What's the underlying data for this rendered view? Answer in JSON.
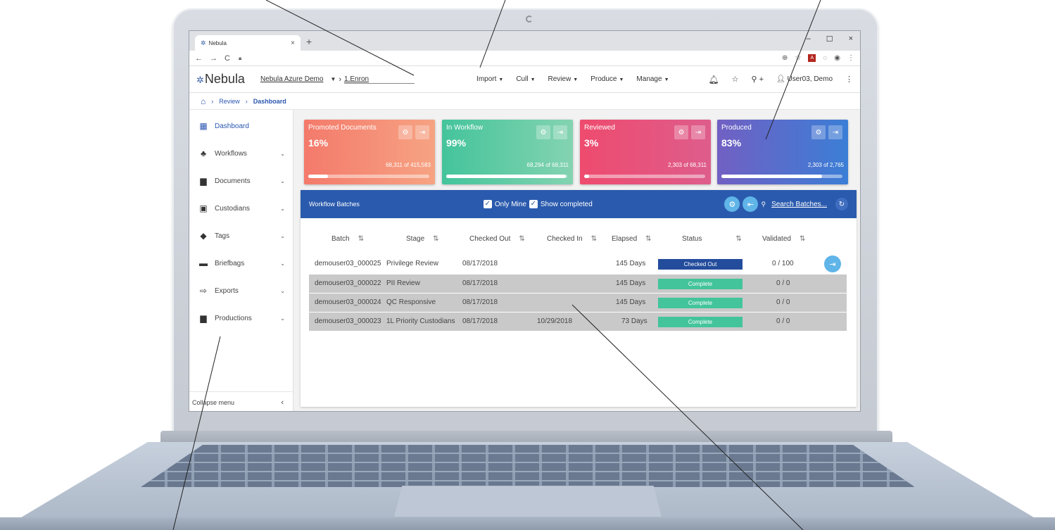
{
  "browser": {
    "tab_title": "Nebula",
    "tab_close": "×",
    "new_tab": "+",
    "min": "–",
    "max": "☐",
    "close": "×"
  },
  "header": {
    "logo": "Nebula",
    "project": "Nebula Azure Demo",
    "case": "1.Enron",
    "menu": [
      "Import",
      "Cull",
      "Review",
      "Produce",
      "Manage"
    ],
    "search_plus": "+",
    "user": "User03, Demo"
  },
  "breadcrumb": [
    "Review",
    "Dashboard"
  ],
  "sidebar": {
    "items": [
      {
        "label": "Dashboard",
        "icon": "dashboard-icon",
        "glyph": "▦"
      },
      {
        "label": "Workflows",
        "icon": "workflow-icon",
        "glyph": "♣"
      },
      {
        "label": "Documents",
        "icon": "document-icon",
        "glyph": "▆"
      },
      {
        "label": "Custodians",
        "icon": "badge-icon",
        "glyph": "▣"
      },
      {
        "label": "Tags",
        "icon": "tag-icon",
        "glyph": "◆"
      },
      {
        "label": "Briefbags",
        "icon": "briefcase-icon",
        "glyph": "▬"
      },
      {
        "label": "Exports",
        "icon": "export-icon",
        "glyph": "⇨"
      },
      {
        "label": "Productions",
        "icon": "file-icon",
        "glyph": "▆"
      }
    ],
    "collapse_label": "Collapse menu"
  },
  "cards": [
    {
      "title": "Promoted Documents",
      "percent": "16%",
      "count": "68,311 of 415,583",
      "fill": 0.16
    },
    {
      "title": "In Workflow",
      "percent": "99%",
      "count": "68,294 of 68,311",
      "fill": 0.99
    },
    {
      "title": "Reviewed",
      "percent": "3%",
      "count": "2,303 of 68,311",
      "fill": 0.03
    },
    {
      "title": "Produced",
      "percent": "83%",
      "count": "2,303 of 2,765",
      "fill": 0.83
    }
  ],
  "batches": {
    "title": "Workflow Batches",
    "only_mine": "Only Mine",
    "show_completed": "Show completed",
    "search_placeholder": "Search Batches...",
    "columns": [
      "Batch",
      "Stage",
      "Checked Out",
      "Checked In",
      "Elapsed",
      "Status",
      "Validated"
    ],
    "rows": [
      {
        "batch": "demouser03_000025",
        "stage": "Privilege Review",
        "checked_out": "08/17/2018",
        "checked_in": "",
        "elapsed": "145 Days",
        "status": "Checked Out",
        "validated": "0 / 100"
      },
      {
        "batch": "demouser03_000022",
        "stage": "PII Review",
        "checked_out": "08/17/2018",
        "checked_in": "",
        "elapsed": "145 Days",
        "status": "Complete",
        "validated": "0 / 0"
      },
      {
        "batch": "demouser03_000024",
        "stage": "QC Responsive",
        "checked_out": "08/17/2018",
        "checked_in": "",
        "elapsed": "145 Days",
        "status": "Complete",
        "validated": "0 / 0"
      },
      {
        "batch": "demouser03_000023",
        "stage": "1L Priority Custodians",
        "checked_out": "08/17/2018",
        "checked_in": "10/29/2018",
        "elapsed": "73 Days",
        "status": "Complete",
        "validated": "0 / 0"
      }
    ]
  }
}
